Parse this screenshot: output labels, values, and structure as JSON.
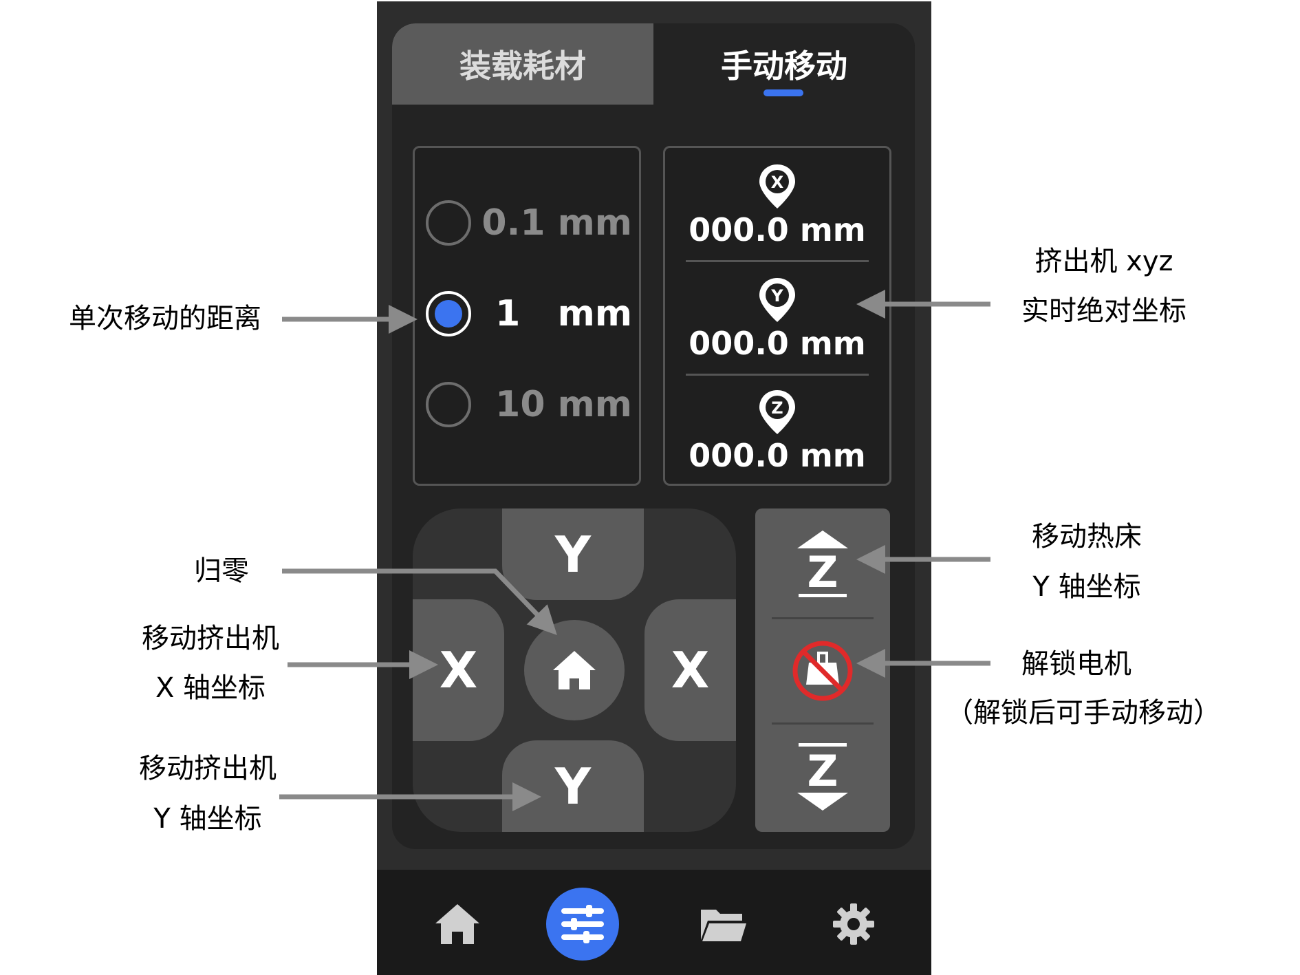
{
  "tabs": {
    "load_filament": "装载耗材",
    "manual_move": "手动移动"
  },
  "step_options": [
    {
      "label": "0.1 mm",
      "selected": false
    },
    {
      "label": "1   mm",
      "selected": true
    },
    {
      "label": "10 mm",
      "selected": false
    }
  ],
  "coords": {
    "x": {
      "axis": "X",
      "value": "000.0 mm"
    },
    "y": {
      "axis": "Y",
      "value": "000.0 mm"
    },
    "z": {
      "axis": "Z",
      "value": "000.0 mm"
    }
  },
  "pad": {
    "y_up": "Y",
    "y_down": "Y",
    "x_left": "X",
    "x_right": "X",
    "home_icon": "home-icon"
  },
  "zcolumn": {
    "up_label": "Z",
    "down_label": "Z",
    "unlock_icon": "motor-unlock-icon"
  },
  "nav": {
    "items": [
      {
        "icon": "home-icon",
        "active": false
      },
      {
        "icon": "sliders-icon",
        "active": true
      },
      {
        "icon": "folder-icon",
        "active": false
      },
      {
        "icon": "gear-icon",
        "active": false
      }
    ]
  },
  "annotations": {
    "step_distance": "单次移动的距离",
    "home": "归零",
    "move_x_line1": "移动挤出机",
    "move_x_line2": "X 轴坐标",
    "move_y_line1": "移动挤出机",
    "move_y_line2": "Y 轴坐标",
    "extruder_line1": "挤出机 xyz",
    "extruder_line2": "实时绝对坐标",
    "bed_line1": "移动热床",
    "bed_line2": "Y 轴坐标",
    "unlock_line1": "解锁电机",
    "unlock_line2": "（解锁后可手动移动）"
  },
  "colors": {
    "accent": "#3b74f0",
    "unlock_red": "#e02a2a",
    "panel": "#232323",
    "button": "#5b5b5b"
  }
}
